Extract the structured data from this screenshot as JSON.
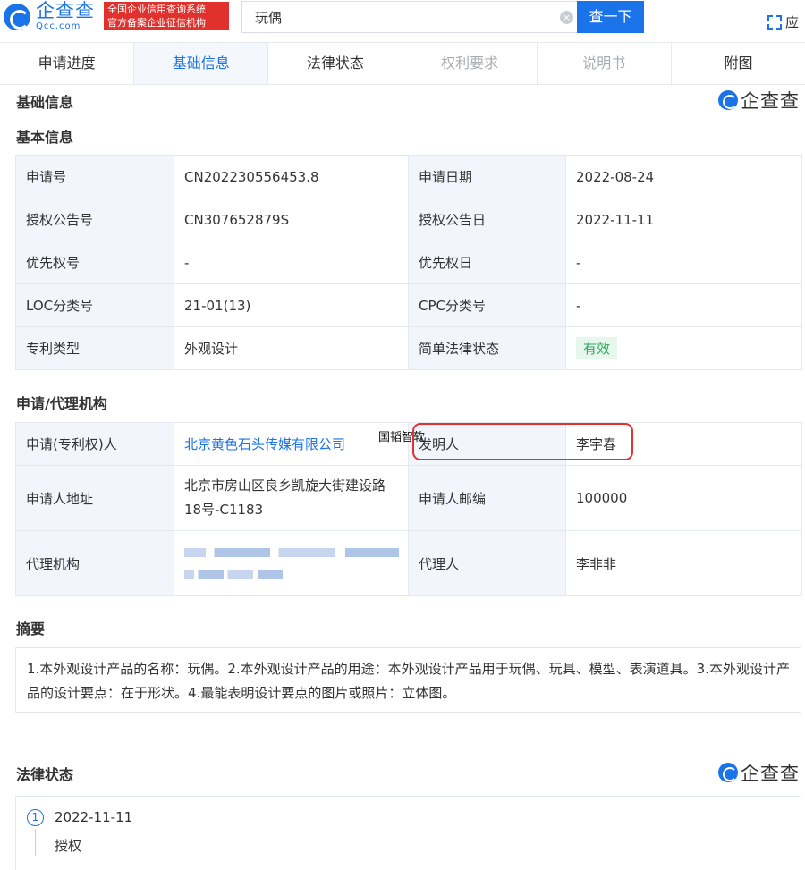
{
  "header": {
    "logo_cn": "企查查",
    "logo_en": "Qcc.com",
    "badge_line1": "全国企业信用查询系统",
    "badge_line2": "官方备案企业征信机构",
    "search_value": "玩偶",
    "search_button": "查一下",
    "app_label": "应"
  },
  "tabs": [
    {
      "label": "申请进度"
    },
    {
      "label": "基础信息"
    },
    {
      "label": "法律状态"
    },
    {
      "label": "权利要求"
    },
    {
      "label": "说明书"
    },
    {
      "label": "附图"
    }
  ],
  "watermark": "企查查",
  "titles": {
    "basic_info": "基础信息",
    "basic_sub": "基本信息",
    "agency": "申请/代理机构",
    "abstract": "摘要",
    "legal": "法律状态"
  },
  "basic_table": [
    [
      "申请号",
      "CN202230556453.8",
      "申请日期",
      "2022-08-24"
    ],
    [
      "授权公告号",
      "CN307652879S",
      "授权公告日",
      "2022-11-11"
    ],
    [
      "优先权号",
      "-",
      "优先权日",
      "-"
    ],
    [
      "LOC分类号",
      "21-01(13)",
      "CPC分类号",
      "-"
    ],
    [
      "专利类型",
      "外观设计",
      "简单法律状态",
      "有效"
    ]
  ],
  "agency_table": {
    "applicant_label": "申请(专利权)人",
    "applicant_value": "北京黄色石头传媒有限公司",
    "inventor_label": "发明人",
    "inventor_value": "李宇春",
    "address_label": "申请人地址",
    "address_value_line1": "北京市房山区良乡凯旋大街建设路",
    "address_value_line2": "18号-C1183",
    "postcode_label": "申请人邮编",
    "postcode_value": "100000",
    "agency_label": "代理机构",
    "agent_label": "代理人",
    "agent_value": "李非非"
  },
  "abstract_text": "1.本外观设计产品的名称：玩偶。2.本外观设计产品的用途：本外观设计产品用于玩偶、玩具、模型、表演道具。3.本外观设计产品的设计要点：在于形状。4.最能表明设计要点的图片或照片：立体图。",
  "legal_status": {
    "step": "1",
    "date": "2022-11-11",
    "text": "授权"
  },
  "annotation": "国韬智软",
  "colors": {
    "accent": "#1a73e8",
    "badge_red": "#e0312c",
    "valid_green": "#2eaa5c",
    "highlight_red": "#e53030"
  }
}
